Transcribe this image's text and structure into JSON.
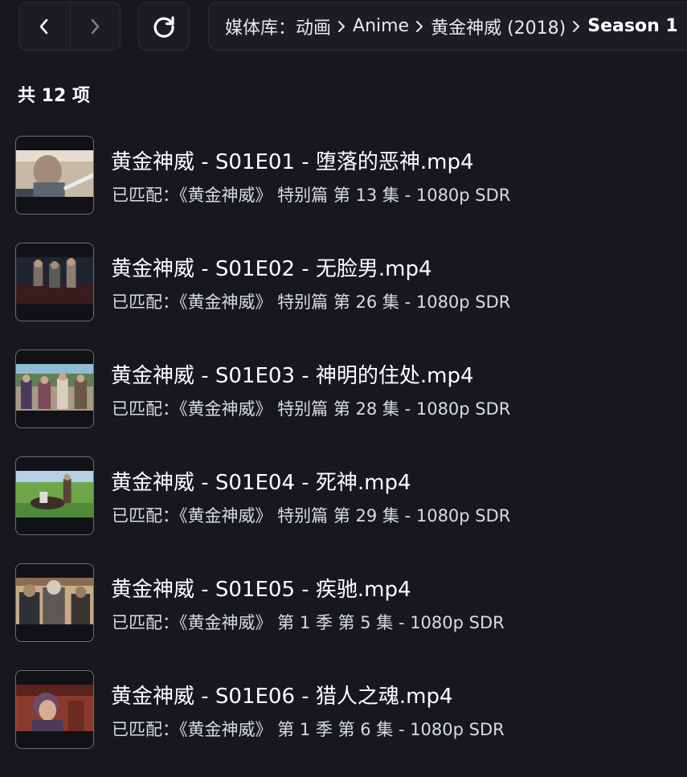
{
  "nav": {
    "back_icon": "chevron-left-icon",
    "forward_icon": "chevron-right-icon",
    "refresh_icon": "refresh-icon"
  },
  "breadcrumb": {
    "items": [
      "媒体库：动画",
      "Anime",
      "黄金神威 (2018)",
      "Season 1"
    ]
  },
  "summary": {
    "count_label": "共 12 项"
  },
  "items": [
    {
      "title": "黄金神威 - S01E01 - 堕落的恶神.mp4",
      "match": "已匹配：《黄金神威》 特别篇 第 13 集 - 1080p SDR"
    },
    {
      "title": "黄金神威 - S01E02 - 无脸男.mp4",
      "match": "已匹配：《黄金神威》 特别篇 第 26 集 - 1080p SDR"
    },
    {
      "title": "黄金神威 - S01E03 - 神明的住处.mp4",
      "match": "已匹配：《黄金神威》 特别篇 第 28 集 - 1080p SDR"
    },
    {
      "title": "黄金神威 - S01E04 - 死神.mp4",
      "match": "已匹配：《黄金神威》 特别篇 第 29 集 - 1080p SDR"
    },
    {
      "title": "黄金神威 - S01E05 - 疾驰.mp4",
      "match": "已匹配：《黄金神威》 第 1 季 第 5 集 - 1080p SDR"
    },
    {
      "title": "黄金神威 - S01E06 - 猎人之魂.mp4",
      "match": "已匹配：《黄金神威》 第 1 季 第 6 集 - 1080p SDR"
    }
  ],
  "colors": {
    "background": "#16181d",
    "panel": "#1b1d22",
    "border": "#2b2e35"
  }
}
